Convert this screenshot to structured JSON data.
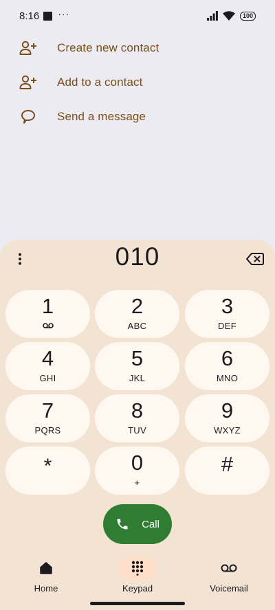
{
  "status_bar": {
    "time": "8:16",
    "dots": "···",
    "battery": "100"
  },
  "actions": [
    {
      "label": "Create new contact",
      "icon": "add-person-icon"
    },
    {
      "label": "Add to a contact",
      "icon": "add-person-icon"
    },
    {
      "label": "Send a message",
      "icon": "message-bubble-icon"
    }
  ],
  "dialer": {
    "number": "010",
    "keys": [
      {
        "digit": "1",
        "letters": "",
        "sub_icon": "voicemail-icon"
      },
      {
        "digit": "2",
        "letters": "ABC"
      },
      {
        "digit": "3",
        "letters": "DEF"
      },
      {
        "digit": "4",
        "letters": "GHI"
      },
      {
        "digit": "5",
        "letters": "JKL"
      },
      {
        "digit": "6",
        "letters": "MNO"
      },
      {
        "digit": "7",
        "letters": "PQRS"
      },
      {
        "digit": "8",
        "letters": "TUV"
      },
      {
        "digit": "9",
        "letters": "WXYZ"
      },
      {
        "digit": "*",
        "letters": ""
      },
      {
        "digit": "0",
        "letters": "+"
      },
      {
        "digit": "#",
        "letters": ""
      }
    ],
    "call_label": "Call"
  },
  "nav": {
    "items": [
      {
        "label": "Home",
        "icon": "home-icon",
        "active": false
      },
      {
        "label": "Keypad",
        "icon": "dialpad-icon",
        "active": true
      },
      {
        "label": "Voicemail",
        "icon": "voicemail-icon",
        "active": false
      }
    ]
  },
  "colors": {
    "background": "#ecebf2",
    "sheet": "#f3e3d3",
    "key": "#fff8f0",
    "action_text": "#7a4f19",
    "call_button": "#2e7d32",
    "nav_active": "#ffdfc7"
  }
}
